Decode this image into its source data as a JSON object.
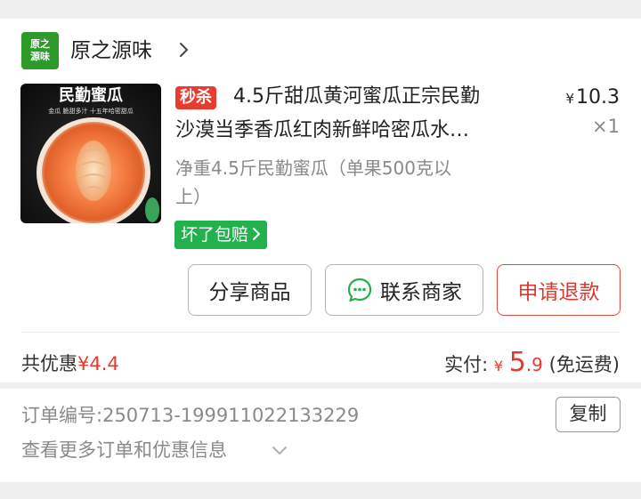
{
  "store": {
    "logo_line1": "原之",
    "logo_line2": "源味",
    "name": "原之源味",
    "brand_color": "#2e9a2a"
  },
  "product": {
    "image_text_big": "民勤蜜瓜",
    "image_text_small": "金瓜  脆甜多汁  十五年哈密甜瓜",
    "seckill_badge": "秒杀",
    "title_line1": "4.5斤甜瓜黄河蜜瓜正宗民勤",
    "title_line2": "沙漠当季香瓜红肉新鲜哈密瓜水…",
    "price_symbol": "¥",
    "price_value": "10.3",
    "quantity": "×1",
    "spec_line1": "净重4.5斤民勤蜜瓜（单果500克以",
    "spec_line2": "上）",
    "guarantee_label": "坏了包赔"
  },
  "actions": {
    "share_label": "分享商品",
    "contact_label": "联系商家",
    "refund_label": "申请退款"
  },
  "summary": {
    "discount_label": "共优惠",
    "discount_value": "¥4.4",
    "paid_label": "实付:",
    "paid_symbol": "¥",
    "paid_int": "5",
    "paid_dec": ".9",
    "shipping_note": "(免运费)"
  },
  "order": {
    "number_label": "订单编号:",
    "number_value": "250713-199911022133229",
    "copy_label": "复制",
    "more_info_label": "查看更多订单和优惠信息"
  },
  "colors": {
    "accent_red": "#e23b2e",
    "seckill_red": "#ea3b2f",
    "guarantee_green": "#22b14c",
    "wechat_green": "#22b14c"
  },
  "icons": {
    "store_chevron": "chevron-right-icon",
    "contact": "chat-bubble-icon",
    "more_chevron": "chevron-down-icon"
  }
}
